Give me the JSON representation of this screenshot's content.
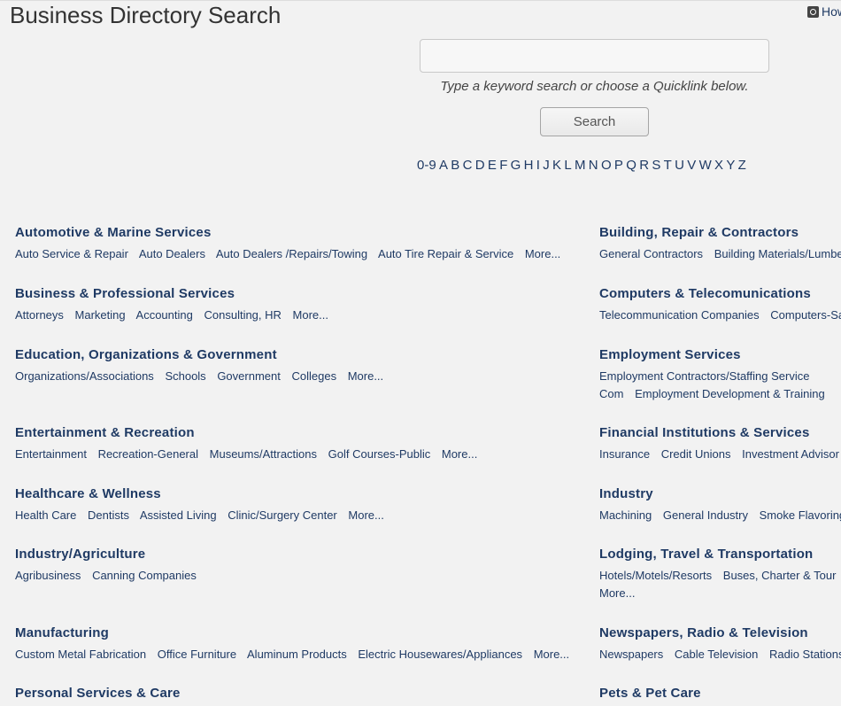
{
  "header": {
    "title": "Business Directory Search",
    "help_link": "How To",
    "help_icon": "camera-icon"
  },
  "search": {
    "value": "",
    "placeholder": "",
    "hint": "Type a keyword search or choose a Quicklink below.",
    "button_label": "Search"
  },
  "alphabet": [
    "0-9",
    "A",
    "B",
    "C",
    "D",
    "E",
    "F",
    "G",
    "H",
    "I",
    "J",
    "K",
    "L",
    "M",
    "N",
    "O",
    "P",
    "Q",
    "R",
    "S",
    "T",
    "U",
    "V",
    "W",
    "X",
    "Y",
    "Z"
  ],
  "categories_left": [
    {
      "title": "Automotive & Marine Services",
      "links": [
        "Auto Service & Repair",
        "Auto Dealers",
        "Auto Dealers /Repairs/Towing",
        "Auto Tire Repair & Service",
        "More..."
      ]
    },
    {
      "title": "Business & Professional Services",
      "links": [
        "Attorneys",
        "Marketing",
        "Accounting",
        "Consulting, HR",
        "More..."
      ]
    },
    {
      "title": "Education, Organizations & Government",
      "links": [
        "Organizations/Associations",
        "Schools",
        "Government",
        "Colleges",
        "More..."
      ]
    },
    {
      "title": "Entertainment & Recreation",
      "links": [
        "Entertainment",
        "Recreation-General",
        "Museums/Attractions",
        "Golf Courses-Public",
        "More..."
      ]
    },
    {
      "title": "Healthcare & Wellness",
      "links": [
        "Health Care",
        "Dentists",
        "Assisted Living",
        "Clinic/Surgery Center",
        "More..."
      ]
    },
    {
      "title": "Industry/Agriculture",
      "links": [
        "Agribusiness",
        "Canning Companies"
      ]
    },
    {
      "title": "Manufacturing",
      "links": [
        "Custom Metal Fabrication",
        "Office Furniture",
        "Aluminum Products",
        "Electric Housewares/Appliances",
        "More..."
      ]
    },
    {
      "title": "Personal Services & Care",
      "links": []
    }
  ],
  "categories_right": [
    {
      "title": "Building, Repair & Contractors",
      "links": [
        "General Contractors",
        "Building Materials/Lumber"
      ]
    },
    {
      "title": "Computers & Telecomunications",
      "links": [
        "Telecommunication Companies",
        "Computers-Sales"
      ]
    },
    {
      "title": "Employment Services",
      "links": [
        "Employment Contractors/Staffing Service",
        "Com",
        "Employment Development & Training"
      ]
    },
    {
      "title": "Financial Institutions & Services",
      "links": [
        "Insurance",
        "Credit Unions",
        "Investment Advisor"
      ]
    },
    {
      "title": "Industry",
      "links": [
        "Machining",
        "General Industry",
        "Smoke Flavoring"
      ]
    },
    {
      "title": "Lodging, Travel & Transportation",
      "links": [
        "Hotels/Motels/Resorts",
        "Buses, Charter & Tour",
        "More..."
      ]
    },
    {
      "title": "Newspapers, Radio & Television",
      "links": [
        "Newspapers",
        "Cable Television",
        "Radio Stations"
      ]
    },
    {
      "title": "Pets & Pet Care",
      "links": []
    }
  ]
}
